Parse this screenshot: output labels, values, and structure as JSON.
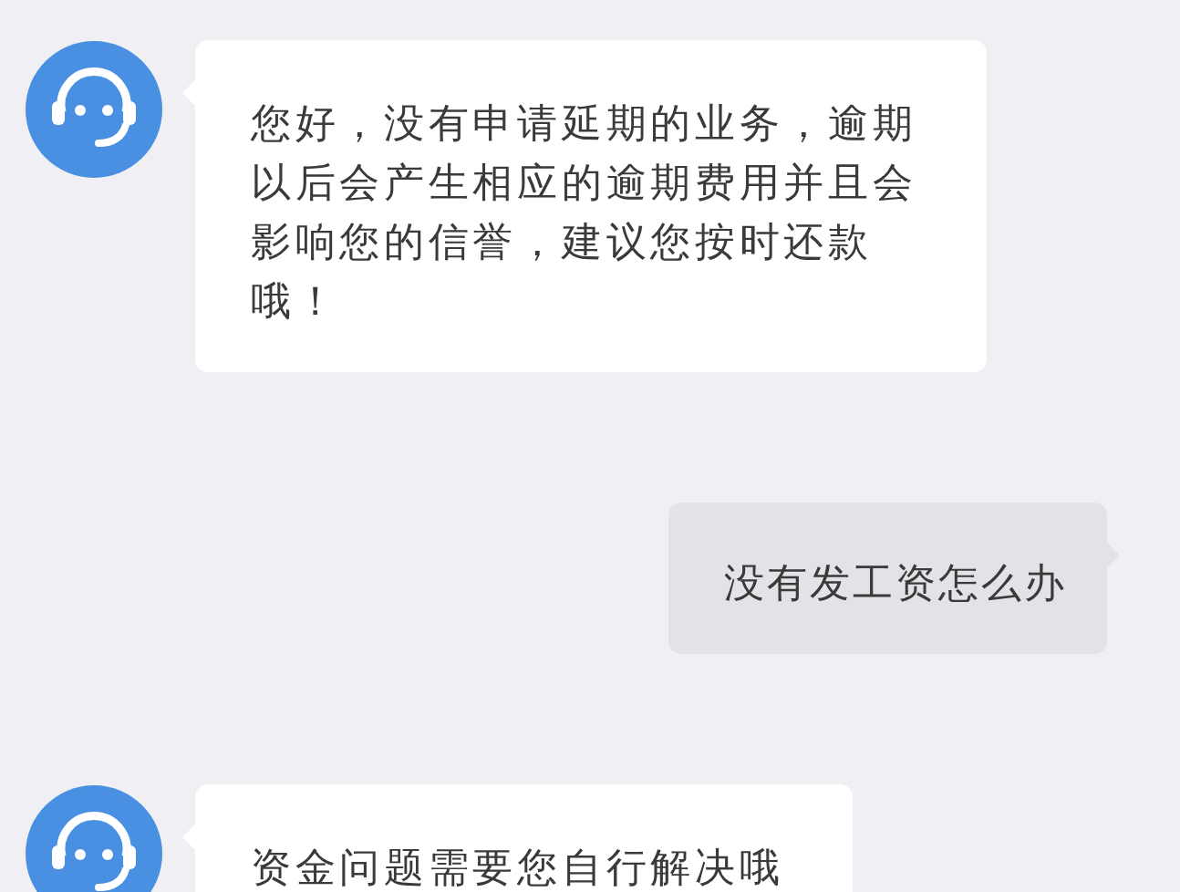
{
  "messages": [
    {
      "kind": "bot",
      "text": "您好，没有申请延期的业务，逾期以后会产生相应的逾期费用并且会影响您的信誉，建议您按时还款哦！"
    },
    {
      "kind": "user",
      "text": "没有发工资怎么办"
    },
    {
      "kind": "bot",
      "text": "资金问题需要您自行解决哦"
    }
  ]
}
